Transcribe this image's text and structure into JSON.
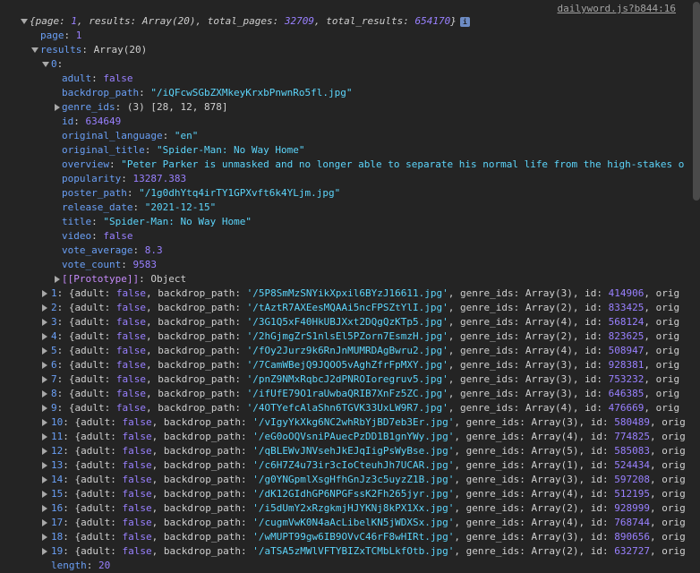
{
  "source_link": "dailyword.js?b844:16",
  "summary": {
    "open": "{",
    "k_page": "page",
    "v_page": "1",
    "k_results": "results",
    "v_results": "Array(20)",
    "k_total_pages": "total_pages",
    "v_total_pages": "32709",
    "k_total_results": "total_results",
    "v_total_results": "654170",
    "close": "}",
    "info_glyph": "i"
  },
  "page_prop": {
    "key": "page",
    "value": "1"
  },
  "results_prop": {
    "key": "results",
    "value": "Array(20)"
  },
  "item0": {
    "index": "0",
    "props": [
      {
        "key": "adult",
        "value": "false",
        "type": "bool"
      },
      {
        "key": "backdrop_path",
        "value": "\"/iQFcwSGbZXMkeyKrxbPnwnRo5fl.jpg\"",
        "type": "str"
      },
      {
        "key": "genre_ids",
        "value": "(3) [28, 12, 878]",
        "type": "arr",
        "expander": true
      },
      {
        "key": "id",
        "value": "634649",
        "type": "num"
      },
      {
        "key": "original_language",
        "value": "\"en\"",
        "type": "str"
      },
      {
        "key": "original_title",
        "value": "\"Spider-Man: No Way Home\"",
        "type": "str"
      },
      {
        "key": "overview",
        "value": "\"Peter Parker is unmasked and no longer able to separate his normal life from the high-stakes o",
        "type": "str"
      },
      {
        "key": "popularity",
        "value": "13287.383",
        "type": "num"
      },
      {
        "key": "poster_path",
        "value": "\"/1g0dhYtq4irTY1GPXvft6k4YLjm.jpg\"",
        "type": "str"
      },
      {
        "key": "release_date",
        "value": "\"2021-12-15\"",
        "type": "str"
      },
      {
        "key": "title",
        "value": "\"Spider-Man: No Way Home\"",
        "type": "str"
      },
      {
        "key": "video",
        "value": "false",
        "type": "bool"
      },
      {
        "key": "vote_average",
        "value": "8.3",
        "type": "num"
      },
      {
        "key": "vote_count",
        "value": "9583",
        "type": "num"
      }
    ],
    "prototype": {
      "key": "[[Prototype]]",
      "value": "Object"
    }
  },
  "collapsed_items": [
    {
      "index": "1",
      "path": "'/5P8SmMzSNYikXpxil6BYzJ16611.jpg'",
      "genre": "Array(3)",
      "id": "414906"
    },
    {
      "index": "2",
      "path": "'/tAztR7AXEesMQAAi5ncFPSZtYlI.jpg'",
      "genre": "Array(2)",
      "id": "833425"
    },
    {
      "index": "3",
      "path": "'/3G1Q5xF40HkUBJXxt2DQgQzKTp5.jpg'",
      "genre": "Array(4)",
      "id": "568124"
    },
    {
      "index": "4",
      "path": "'/2hGjmgZrS1nlsEl5PZorn7EsmzH.jpg'",
      "genre": "Array(2)",
      "id": "823625"
    },
    {
      "index": "5",
      "path": "'/fOy2Jurz9k6RnJnMUMRDAgBwru2.jpg'",
      "genre": "Array(4)",
      "id": "508947"
    },
    {
      "index": "6",
      "path": "'/7CamWBejQ9JQOO5vAghZfrFpMXY.jpg'",
      "genre": "Array(3)",
      "id": "928381"
    },
    {
      "index": "7",
      "path": "'/pnZ9NMxRqbcJ2dPNROIoregruv5.jpg'",
      "genre": "Array(3)",
      "id": "753232"
    },
    {
      "index": "8",
      "path": "'/ifUfE79O1raUwbaQRIB7XnFz5ZC.jpg'",
      "genre": "Array(3)",
      "id": "646385"
    },
    {
      "index": "9",
      "path": "'/4OTYefcAlaShn6TGVK33UxLW9R7.jpg'",
      "genre": "Array(4)",
      "id": "476669"
    },
    {
      "index": "10",
      "path": "'/vIgyYkXkg6NC2whRbYjBD7eb3Er.jpg'",
      "genre": "Array(3)",
      "id": "580489"
    },
    {
      "index": "11",
      "path": "'/eG0oOQVsniPAuecPzDD1B1gnYWy.jpg'",
      "genre": "Array(4)",
      "id": "774825"
    },
    {
      "index": "12",
      "path": "'/qBLEWvJNVsehJkEJqIigPsWyBse.jpg'",
      "genre": "Array(5)",
      "id": "585083"
    },
    {
      "index": "13",
      "path": "'/c6H7Z4u73ir3cIoCteuhJh7UCAR.jpg'",
      "genre": "Array(1)",
      "id": "524434"
    },
    {
      "index": "14",
      "path": "'/g0YNGpmlXsgHfhGnJz3c5uyzZ1B.jpg'",
      "genre": "Array(3)",
      "id": "597208"
    },
    {
      "index": "15",
      "path": "'/dK12GIdhGP6NPGFssK2Fh265jyr.jpg'",
      "genre": "Array(4)",
      "id": "512195"
    },
    {
      "index": "16",
      "path": "'/i5dUmY2xRzgkmjHJYKNj8kPX1Xx.jpg'",
      "genre": "Array(2)",
      "id": "928999"
    },
    {
      "index": "17",
      "path": "'/cugmVwK0N4aAcLibelKN5jWDXSx.jpg'",
      "genre": "Array(4)",
      "id": "768744"
    },
    {
      "index": "18",
      "path": "'/wMUPT99gw6IB9OVvC46rF8wHIRt.jpg'",
      "genre": "Array(3)",
      "id": "890656"
    },
    {
      "index": "19",
      "path": "'/aTSA5zMWlVFTYBIZxTCMbLkfOtb.jpg'",
      "genre": "Array(2)",
      "id": "632727"
    }
  ],
  "row_text": {
    "open": "{",
    "adult_key": "adult",
    "adult_val": "false",
    "backdrop_key": "backdrop_path",
    "genre_key": "genre_ids",
    "id_key": "id",
    "trail": "orig"
  },
  "length_prop": {
    "key": "length",
    "value": "20"
  }
}
